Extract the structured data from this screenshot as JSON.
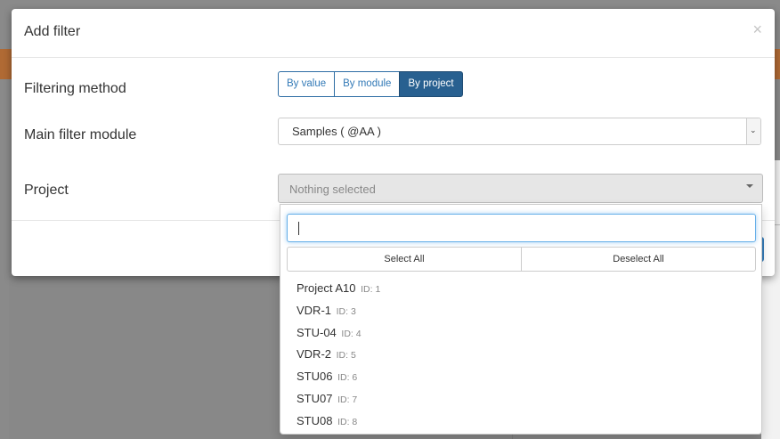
{
  "modal": {
    "title": "Add filter",
    "close_glyph": "×"
  },
  "filtering_method": {
    "label": "Filtering method",
    "options": [
      "By value",
      "By module",
      "By project"
    ],
    "active": "By project"
  },
  "main_filter_module": {
    "label": "Main filter module",
    "value": "Samples ( @AA )"
  },
  "project": {
    "label": "Project",
    "placeholder": "Nothing selected",
    "search_value": "",
    "select_all_label": "Select All",
    "deselect_all_label": "Deselect All",
    "items": [
      {
        "name": "Project A10",
        "id": "ID: 1"
      },
      {
        "name": "VDR-1",
        "id": "ID: 3"
      },
      {
        "name": "STU-04",
        "id": "ID: 4"
      },
      {
        "name": "VDR-2",
        "id": "ID: 5"
      },
      {
        "name": "STU06",
        "id": "ID: 6"
      },
      {
        "name": "STU07",
        "id": "ID: 7"
      },
      {
        "name": "STU08",
        "id": "ID: 8"
      }
    ]
  },
  "colors": {
    "primary": "#337ab7",
    "active_button": "#286090",
    "header_bar": "#b06a34"
  }
}
